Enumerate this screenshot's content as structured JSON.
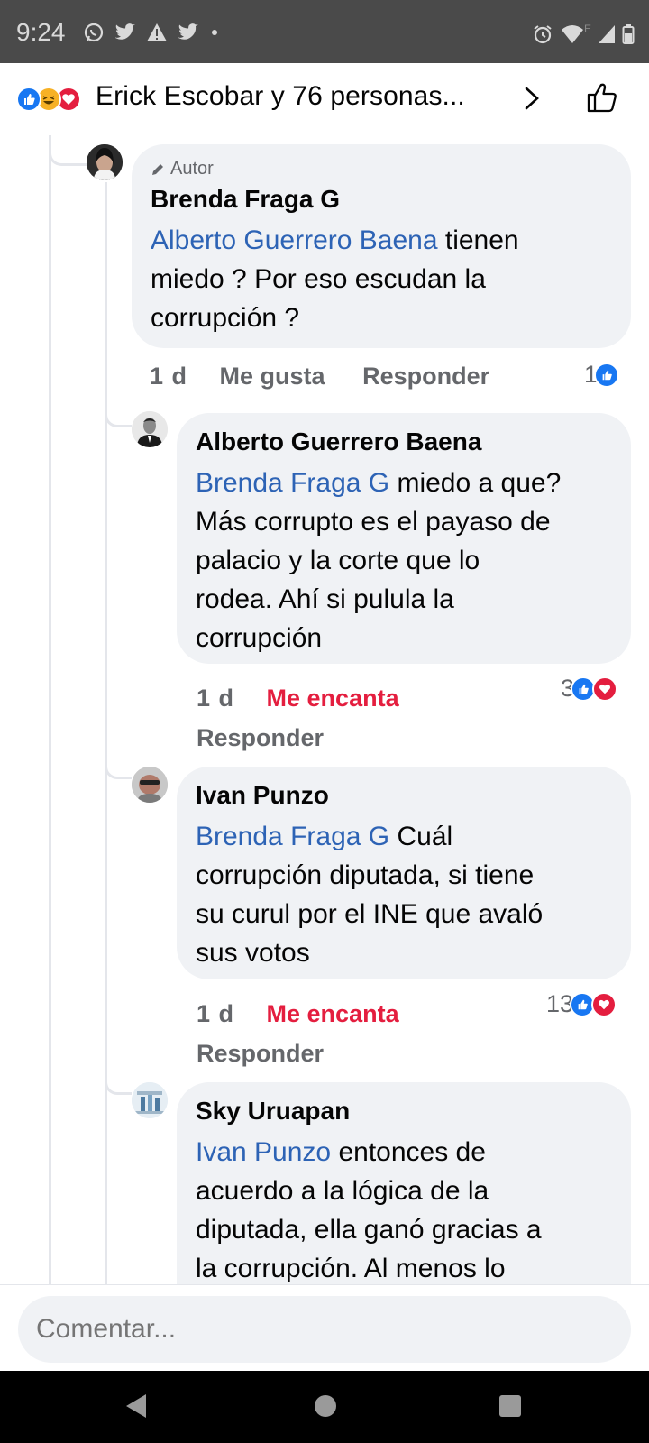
{
  "status_bar": {
    "time": "9:24",
    "left_icons": [
      "whatsapp-icon",
      "twitter-icon",
      "alert-icon",
      "twitter-icon",
      "dot-icon"
    ],
    "right_icons": [
      "alarm-icon",
      "wifi-icon",
      "signal-icon",
      "battery-icon"
    ],
    "network_label": "E"
  },
  "header": {
    "reaction_icons": [
      "like-reaction",
      "haha-reaction",
      "love-reaction"
    ],
    "title": "Erick Escobar y 76 personas...",
    "chevron_icon": "chevron-right-icon",
    "like_icon": "thumbs-up-outline-icon"
  },
  "comments": [
    {
      "badge": "Autor",
      "name": "Brenda Fraga G",
      "mention": "Alberto Guerrero Baena",
      "text_l1": "tienen",
      "text_l2": "miedo ? Por eso escudan la",
      "text_l3": "corrupción ?",
      "time": "1 d",
      "like_label": "Me gusta",
      "reply_label": "Responder",
      "reaction_count": "1"
    },
    {
      "name": "Alberto Guerrero Baena",
      "mention": "Brenda Fraga G",
      "text_l1": "miedo a que?",
      "text_l2": "Más corrupto es el payaso de",
      "text_l3": "palacio y la corte que lo",
      "text_l4": "rodea. Ahí si pulula la",
      "text_l5": "corrupción",
      "time": "1 d",
      "like_label": "Me encanta",
      "reply_label": "Responder",
      "reaction_count": "3"
    },
    {
      "name": "Ivan Punzo",
      "mention": "Brenda Fraga G",
      "text_l1": "Cuál",
      "text_l2": "corrupción diputada, si tiene",
      "text_l3": "su curul por el INE que avaló",
      "text_l4": "sus votos",
      "time": "1 d",
      "like_label": "Me encanta",
      "reply_label": "Responder",
      "reaction_count": "13"
    },
    {
      "name": "Sky Uruapan",
      "mention": "Ivan Punzo",
      "text_l1": "entonces de",
      "text_l2": "acuerdo a la lógica de la",
      "text_l3": "diputada, ella ganó gracias a",
      "text_l4": "la corrupción. Al menos lo"
    }
  ],
  "comment_input": {
    "placeholder": "Comentar..."
  },
  "nav_bar": {
    "icons": [
      "back-icon",
      "home-icon",
      "recents-icon"
    ]
  },
  "colors": {
    "mention": "#2d63b5",
    "love": "#e41e3f",
    "like_blue": "#1877f2",
    "bubble": "#f0f2f5"
  }
}
